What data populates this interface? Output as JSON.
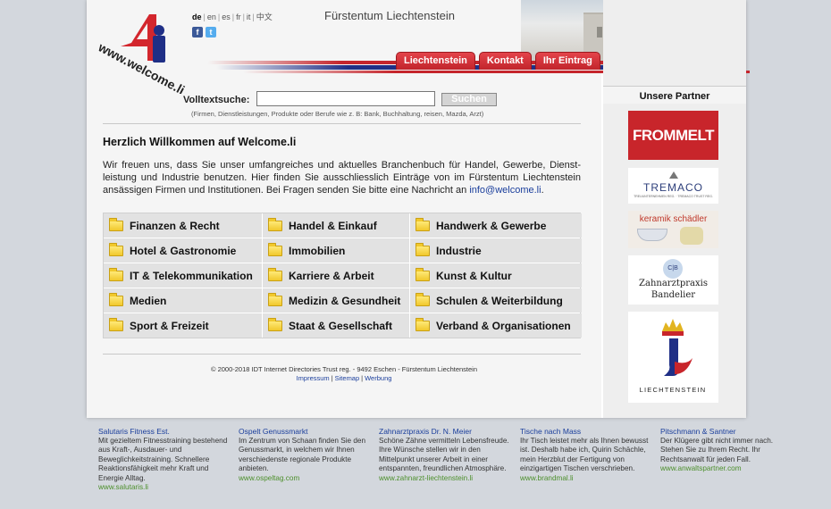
{
  "header": {
    "logo_text": "www.welcome.li",
    "languages": [
      {
        "code": "de",
        "active": true
      },
      {
        "code": "en",
        "active": false
      },
      {
        "code": "es",
        "active": false
      },
      {
        "code": "fr",
        "active": false
      },
      {
        "code": "it",
        "active": false
      },
      {
        "code": "中文",
        "active": false
      }
    ],
    "social_icons": [
      "facebook-icon",
      "twitter-icon"
    ],
    "site_title": "Fürstentum Liechtenstein",
    "tabs": [
      "Liechtenstein",
      "Kontakt",
      "Ihr Eintrag"
    ]
  },
  "search": {
    "label": "Volltextsuche:",
    "value": "",
    "button": "Suchen",
    "hint": "(Firmen, Dienstleistungen, Produkte oder Berufe wie z. B: Bank, Buchhaltung, reisen, Mazda, Arzt)"
  },
  "welcome": {
    "title": "Herzlich Willkommen auf Welcome.li",
    "text": "Wir freuen uns, dass Sie unser umfangreiches und aktuelles Branchenbuch für Handel, Gewerbe, Dienst-leistung und Industrie benutzen. Hier finden Sie ausschliesslich Einträge von im Fürstentum Liechtenstein ansässigen Firmen und Institutionen. Bei Fragen senden Sie bitte eine Nachricht an",
    "email": "info@welcome.li",
    "end": "."
  },
  "categories": [
    "Finanzen & Recht",
    "Handel & Einkauf",
    "Handwerk & Gewerbe",
    "Hotel & Gastronomie",
    "Immobilien",
    "Industrie",
    "IT & Telekommunikation",
    "Karriere & Arbeit",
    "Kunst & Kultur",
    "Medien",
    "Medizin & Gesundheit",
    "Schulen & Weiterbildung",
    "Sport & Freizeit",
    "Staat & Gesellschaft",
    "Verband & Organisationen"
  ],
  "footer": {
    "copyright": "© 2000-2018 IDT Internet Directories Trust reg. - 9492 Eschen - Fürstentum Liechtenstein",
    "links": [
      "Impressum",
      "Sitemap",
      "Werbung"
    ]
  },
  "sidebar": {
    "title": "Unsere Partner",
    "partners": [
      {
        "name": "FROMMELT",
        "color": "#c8252b"
      },
      {
        "name": "TREMACO",
        "sub": "TREUUNTERNEHMEN REG. · TREMACO TRUST REG."
      },
      {
        "name": "keramik schädler",
        "color": "#c0392b"
      },
      {
        "name": "Zahnarztpraxis Bandelier",
        "mono": "C|B",
        "line1": "Zahnarztpraxis",
        "line2": "Bandelier"
      },
      {
        "name": "LIECHTENSTEIN"
      }
    ]
  },
  "ads": [
    {
      "title": "Salutaris Fitness Est.",
      "text": "Mit gezieltem Fitnesstraining bestehend aus Kraft-, Ausdauer- und Beweglichkeitstraining. Schnellere Reaktionsfähigkeit mehr Kraft und Energie Alltag.",
      "url": "www.salutaris.li"
    },
    {
      "title": "Ospelt Genussmarkt",
      "text": "Im Zentrum von Schaan finden Sie den Genussmarkt, in welchem wir Ihnen verschiedenste regionale Produkte anbieten.",
      "url": "www.ospeltag.com"
    },
    {
      "title": "Zahnarztpraxis Dr. N. Meier",
      "text": "Schöne Zähne vermitteln Lebensfreude. Ihre Wünsche stellen wir in den Mittelpunkt unserer Arbeit in einer entspannten, freundlichen Atmosphäre.",
      "url": "www.zahnarzt-liechtenstein.li"
    },
    {
      "title": "Tische nach Mass",
      "text": "Ihr Tisch leistet mehr als Ihnen bewusst ist. Deshalb habe ich, Quirin Schächle, mein Herzblut der Fertigung von einzigartigen Tischen verschrieben.",
      "url": "www.brandmal.li"
    },
    {
      "title": "Pitschmann & Santner",
      "text": "Der Klügere gibt nicht immer nach. Stehen Sie zu Ihrem Recht. Ihr Rechtsanwalt für jeden Fall.",
      "url": "www.anwaltspartner.com"
    }
  ]
}
